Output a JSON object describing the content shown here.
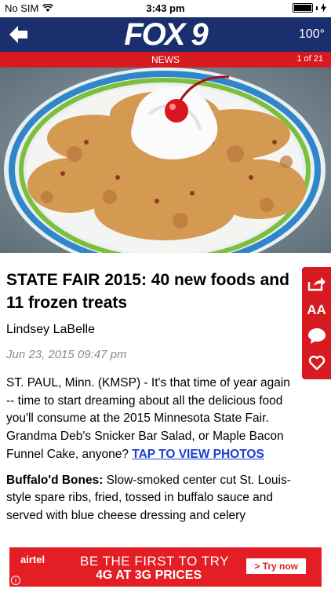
{
  "status_bar": {
    "carrier": "No SIM",
    "time": "3:43 pm"
  },
  "header": {
    "logo_text": "FOX 9",
    "temperature": "100°",
    "brand_color": "#1b2f6e"
  },
  "section_bar": {
    "section": "NEWS",
    "pager": "1 of 21",
    "color": "#d71920"
  },
  "hero_image": {
    "description_icon": "funnel-cake-photo"
  },
  "article": {
    "headline": "STATE FAIR 2015: 40 new foods and 11 frozen treats",
    "author": "Lindsey LaBelle",
    "date": "Jun 23, 2015 09:47 pm",
    "paragraph1": "ST. PAUL, Minn. (KMSP) - It's that time of year again -- time to start dreaming about all the delicious food you'll consume at the 2015 Minnesota State Fair. Grandma Deb's Snicker Bar Salad, or Maple Bacon Funnel Cake, anyone? ",
    "photos_link": "TAP TO VIEW PHOTOS",
    "item1_title": "Buffalo'd Bones:",
    "item1_text": " Slow-smoked center cut St. Louis-style spare ribs, fried, tossed in buffalo sauce and served with blue cheese dressing and celery"
  },
  "action_rail": {
    "font_size_label": "AA",
    "icons": [
      "share-icon",
      "font-size-icon",
      "comment-icon",
      "heart-icon"
    ]
  },
  "ad": {
    "brand": "airtel",
    "line1": "BE THE FIRST TO TRY",
    "line2": "4G AT 3G PRICES",
    "cta": "> Try now",
    "info": "i"
  }
}
